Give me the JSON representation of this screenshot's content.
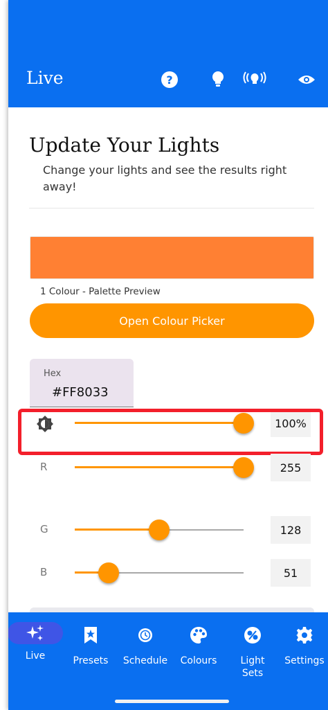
{
  "header": {
    "title": "Live",
    "icons": [
      "help-icon",
      "lightbulb-icon",
      "broadcast-light-icon",
      "eye-icon"
    ]
  },
  "main": {
    "heading": "Update Your Lights",
    "subtitle": "Change your lights and see the results right away!",
    "palette_color": "#FF8033",
    "palette_label": "1 Colour - Palette Preview",
    "picker_button": "Open Colour Picker",
    "hex_label": "Hex",
    "hex_value": "#FF8033",
    "sliders": [
      {
        "label": "",
        "icon": "brightness-icon",
        "value": "100%",
        "fraction": 1.0
      },
      {
        "label": "R",
        "value": "255",
        "fraction": 1.0
      },
      {
        "label": "G",
        "value": "128",
        "fraction": 0.502
      },
      {
        "label": "B",
        "value": "51",
        "fraction": 0.2
      }
    ],
    "accent_color": "#FF9500",
    "highlight_color": "#F31F2B"
  },
  "nav": {
    "tabs": [
      {
        "label": "Live",
        "icon": "sparkles-icon",
        "active": true
      },
      {
        "label": "Presets",
        "icon": "bookmark-star-icon"
      },
      {
        "label": "Schedule",
        "icon": "clock-icon"
      },
      {
        "label": "Colours",
        "icon": "palette-icon"
      },
      {
        "label": "Light\nSets",
        "icon": "light-sets-icon"
      },
      {
        "label": "Settings",
        "icon": "gear-icon"
      }
    ],
    "color": "#0A6FF0"
  }
}
